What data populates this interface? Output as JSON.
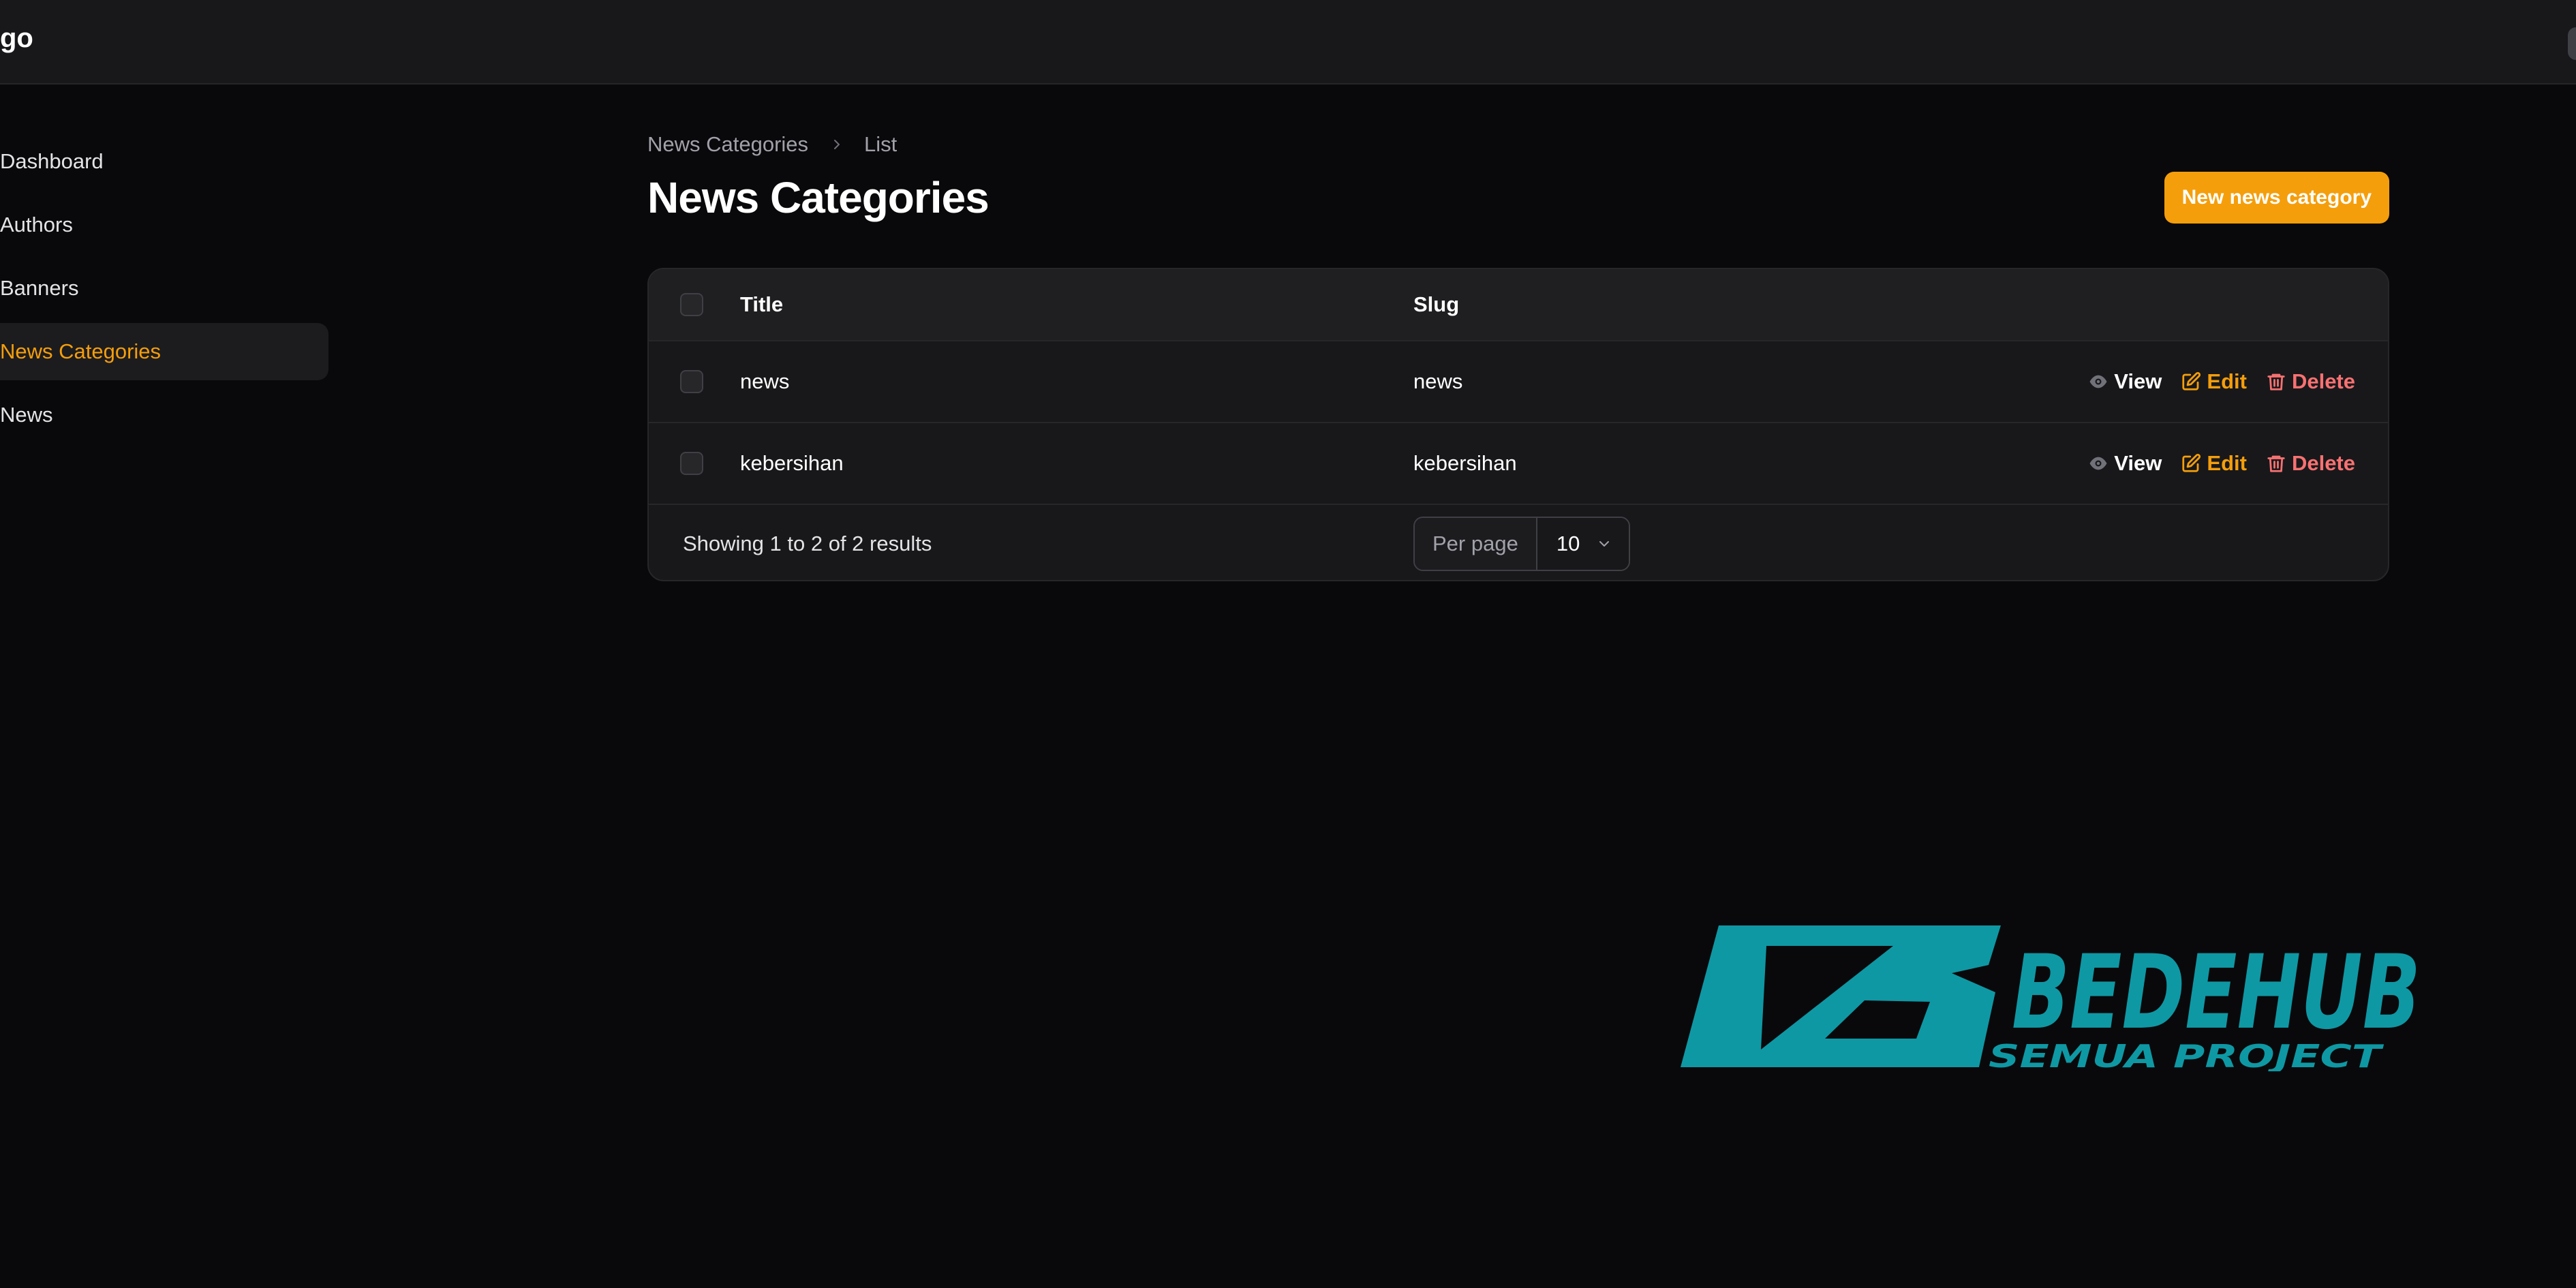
{
  "app": {
    "brand": "go"
  },
  "sidebar": {
    "items": [
      {
        "label": "Dashboard",
        "active": false
      },
      {
        "label": "Authors",
        "active": false
      },
      {
        "label": "Banners",
        "active": false
      },
      {
        "label": "News Categories",
        "active": true
      },
      {
        "label": "News",
        "active": false
      }
    ]
  },
  "breadcrumb": {
    "parent": "News Categories",
    "current": "List"
  },
  "page": {
    "title": "News Categories",
    "new_button": "New news category"
  },
  "table": {
    "columns": {
      "title": "Title",
      "slug": "Slug"
    },
    "rows": [
      {
        "title": "news",
        "slug": "news"
      },
      {
        "title": "kebersihan",
        "slug": "kebersihan"
      }
    ],
    "actions": {
      "view": "View",
      "edit": "Edit",
      "delete": "Delete"
    },
    "footer": {
      "results": "Showing 1 to 2 of 2 results",
      "per_page_label": "Per page",
      "per_page_value": "10"
    }
  },
  "watermark": {
    "name": "BEDEHUB",
    "tagline": "SEMUA PROJECT"
  },
  "colors": {
    "accent": "#f59e0b",
    "danger": "#f87171",
    "watermark": "#0e98a4"
  }
}
